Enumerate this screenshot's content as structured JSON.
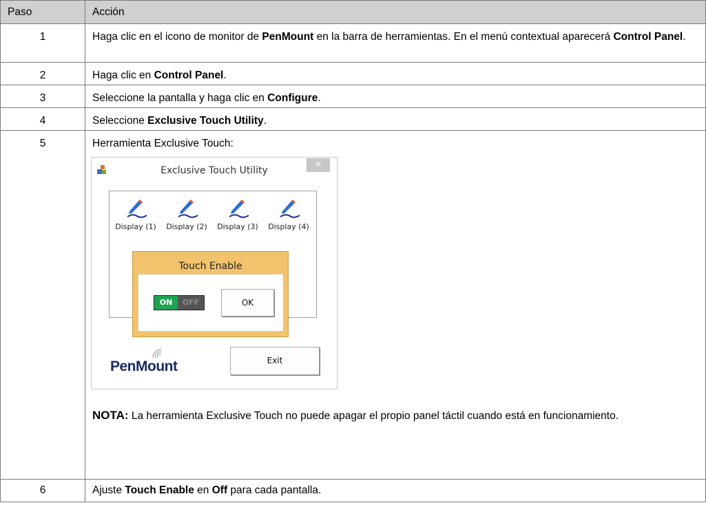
{
  "table": {
    "header": {
      "col_step": "Paso",
      "col_action": "Acción"
    },
    "rows": [
      {
        "num": "1",
        "parts": [
          "Haga clic en el icono de monitor de ",
          "PenMount",
          " en la barra de herramientas. En el menú contextual aparecerá ",
          "Control Panel",
          "."
        ]
      },
      {
        "num": "2",
        "parts": [
          "Haga clic en ",
          "Control Panel",
          "."
        ]
      },
      {
        "num": "3",
        "parts": [
          "Seleccione la pantalla y haga clic en ",
          "Configure",
          "."
        ]
      },
      {
        "num": "4",
        "parts": [
          "Seleccione ",
          "Exclusive Touch Utility",
          "."
        ]
      },
      {
        "num": "5",
        "intro": "Herramienta Exclusive Touch:",
        "note_label": "NOTA:",
        "note_text": " La herramienta Exclusive Touch no puede apagar el propio panel táctil cuando está en funcionamiento."
      },
      {
        "num": "6",
        "parts": [
          "Ajuste ",
          "Touch Enable",
          " en ",
          "Off",
          " para cada pantalla."
        ]
      }
    ]
  },
  "dialog": {
    "title": "Exclusive Touch Utility",
    "close_glyph": "×",
    "displays": [
      "Display (1)",
      "Display (2)",
      "Display (3)",
      "Display (4)"
    ],
    "touch_enable_title": "Touch Enable",
    "toggle_on": "ON",
    "toggle_off": "OFF",
    "ok_label": "OK",
    "logo_text": "PenMount",
    "exit_label": "Exit",
    "colors": {
      "toggle_on": "#1ea351",
      "touch_box": "#f2c36c",
      "logo": "#1b2a60"
    }
  }
}
